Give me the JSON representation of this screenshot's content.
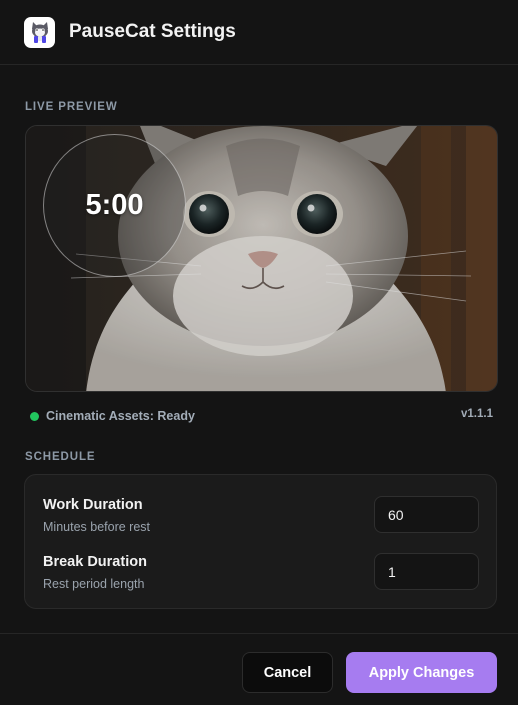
{
  "header": {
    "title": "PauseCat Settings",
    "icon": "cat-app-icon"
  },
  "preview": {
    "section_label": "LIVE PREVIEW",
    "timer": "5:00",
    "image": "cat-photo"
  },
  "status": {
    "text": "Cinematic Assets: Ready",
    "color": "#22c55e",
    "version": "v1.1.1"
  },
  "schedule": {
    "section_label": "SCHEDULE",
    "work": {
      "title": "Work Duration",
      "subtitle": "Minutes before rest",
      "value": "60"
    },
    "break": {
      "title": "Break Duration",
      "subtitle": "Rest period length",
      "value": "1"
    }
  },
  "footer": {
    "cancel_label": "Cancel",
    "apply_label": "Apply Changes",
    "accent": "#a67cf0"
  }
}
